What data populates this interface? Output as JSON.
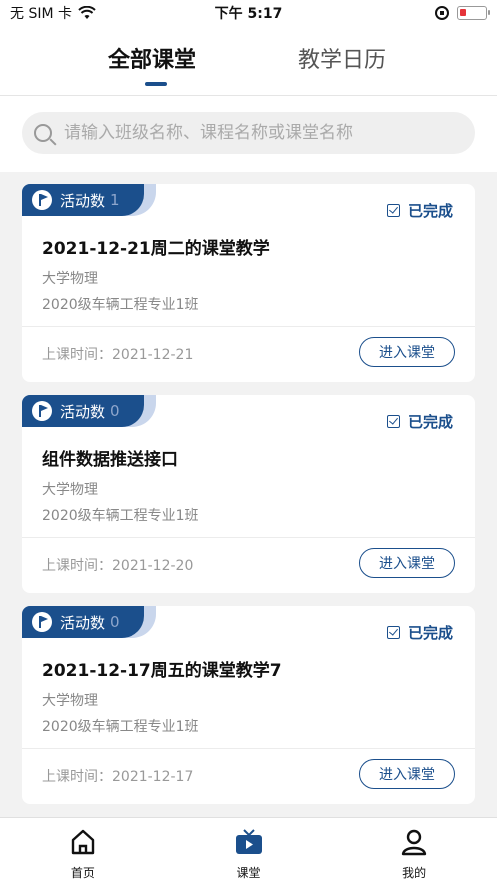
{
  "status_bar": {
    "carrier": "无 SIM 卡",
    "time": "下午 5:17"
  },
  "tabs": [
    {
      "label": "全部课堂",
      "active": true
    },
    {
      "label": "教学日历",
      "active": false
    }
  ],
  "search": {
    "placeholder": "请输入班级名称、课程名称或课堂名称",
    "value": ""
  },
  "cards": [
    {
      "badge_label": "活动数",
      "badge_count": "1",
      "status": "已完成",
      "title": "2021-12-21周二的课堂教学",
      "course": "大学物理",
      "klass": "2020级车辆工程专业1班",
      "time": "上课时间：2021-12-21",
      "action": "进入课堂"
    },
    {
      "badge_label": "活动数",
      "badge_count": "0",
      "status": "已完成",
      "title": "组件数据推送接口",
      "course": "大学物理",
      "klass": "2020级车辆工程专业1班",
      "time": "上课时间：2021-12-20",
      "action": "进入课堂"
    },
    {
      "badge_label": "活动数",
      "badge_count": "0",
      "status": "已完成",
      "title": "2021-12-17周五的课堂教学7",
      "course": "大学物理",
      "klass": "2020级车辆工程专业1班",
      "time": "上课时间：2021-12-17",
      "action": "进入课堂"
    }
  ],
  "bottom_nav": [
    {
      "label": "首页",
      "icon": "home-icon",
      "active": false
    },
    {
      "label": "课堂",
      "icon": "tv-icon",
      "active": true
    },
    {
      "label": "我的",
      "icon": "user-icon",
      "active": false
    }
  ],
  "colors": {
    "accent": "#1b4f8c",
    "background": "#f2f2f2",
    "badge_light": "#c9d6ec"
  }
}
